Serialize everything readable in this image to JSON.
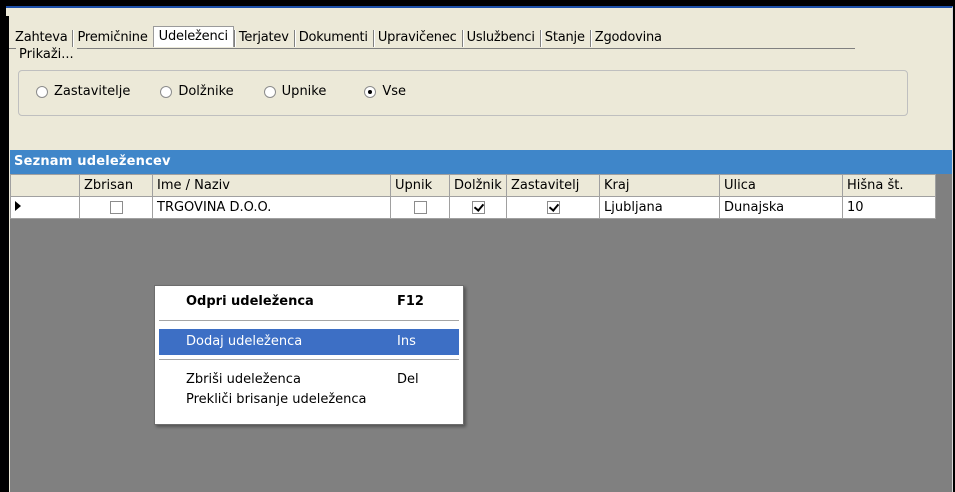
{
  "tabs": [
    "Zahteva",
    "Premičnine",
    "Udeleženci",
    "Terjatev",
    "Dokumenti",
    "Upravičenec",
    "Uslužbenci",
    "Stanje",
    "Zgodovina"
  ],
  "active_tab": "Udeleženci",
  "filter": {
    "legend": "Prikaži...",
    "options": [
      "Zastavitelje",
      "Dolžnike",
      "Upnike",
      "Vse"
    ],
    "selected": "Vse"
  },
  "grid": {
    "title": "Seznam udeležencev",
    "columns": [
      "",
      "Zbrisan",
      "Ime / Naziv",
      "Upnik",
      "Dolžnik",
      "Zastavitelj",
      "Kraj",
      "Ulica",
      "Hišna št."
    ],
    "rows": [
      {
        "zbrisan": false,
        "ime": "TRGOVINA D.O.O.",
        "upnik": false,
        "dolznik": true,
        "zastavitelj": true,
        "kraj": "Ljubljana",
        "ulica": "Dunajska",
        "hisna": "10"
      }
    ]
  },
  "context_menu": {
    "open": {
      "label": "Odpri udeleženca",
      "shortcut": "F12"
    },
    "add": {
      "label": "Dodaj udeleženca",
      "shortcut": "Ins"
    },
    "delete": {
      "label": "Zbriši udeleženca",
      "shortcut": "Del"
    },
    "undelete": {
      "label": "Prekliči brisanje udeleženca"
    }
  },
  "colors": {
    "panel_title": "#3f86c9",
    "menu_highlight": "#3d6fc5",
    "grid_background": "#808080"
  }
}
